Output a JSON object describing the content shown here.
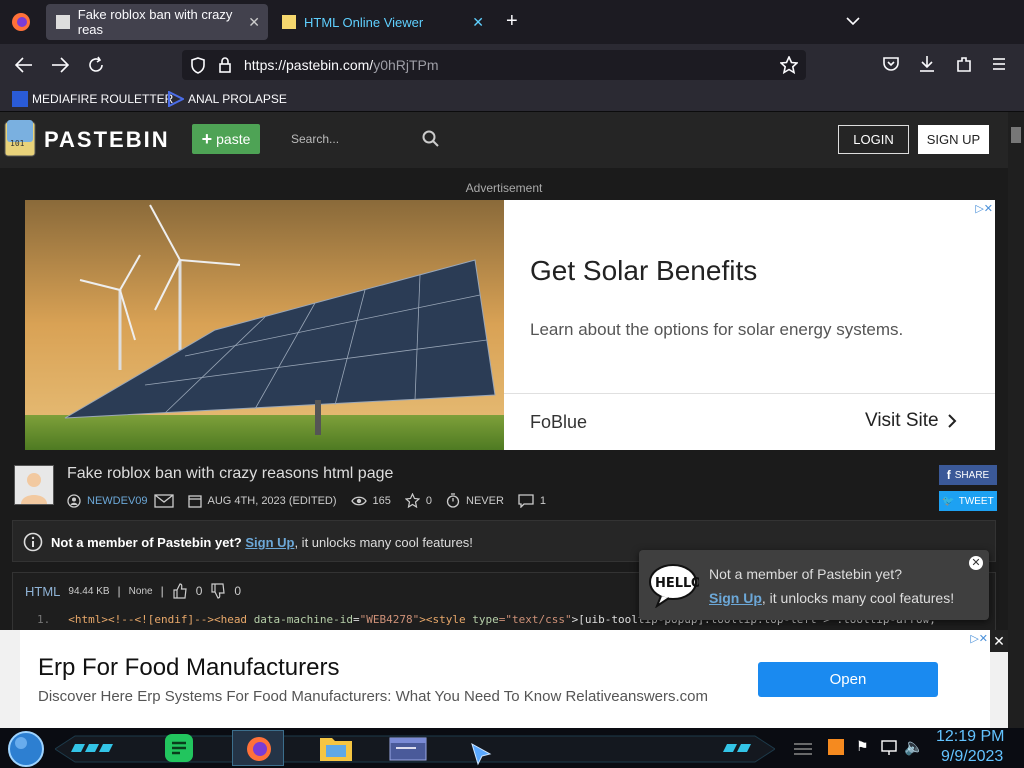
{
  "browser": {
    "tabs": [
      {
        "label": "Fake roblox ban with crazy reas",
        "active": true
      },
      {
        "label": "HTML Online Viewer",
        "active": false
      }
    ],
    "url_host": "https://pastebin.com/",
    "url_path": "y0hRjTPm",
    "bookmarks": [
      "MEDIAFIRE ROULETTER",
      "ANAL PROLAPSE"
    ]
  },
  "header": {
    "logo": "PASTEBIN",
    "paste_label": "paste",
    "search_placeholder": "Search...",
    "login_label": "LOGIN",
    "signup_label": "SIGN UP"
  },
  "ad_top": {
    "label": "Advertisement",
    "title": "Get Solar Benefits",
    "subtitle": "Learn about the options for solar energy systems.",
    "brand": "FoBlue",
    "cta": "Visit Site"
  },
  "paste": {
    "title": "Fake roblox ban with crazy reasons html page",
    "author": "NEWDEV09",
    "date": "AUG 4TH, 2023 (EDITED)",
    "views": "165",
    "stars": "0",
    "expire": "NEVER",
    "comments": "1",
    "share": "SHARE",
    "tweet": "TWEET"
  },
  "notice": {
    "bold": "Not a member of Pastebin yet?",
    "link": "Sign Up",
    "rest": ", it unlocks many cool features!"
  },
  "code": {
    "language": "HTML",
    "size": "94.44",
    "size_unit": "KB",
    "license": "None",
    "likes": "0",
    "dislikes": "0",
    "line_num": "1.",
    "line1_a": "<html><!--<![endif]--><head ",
    "line1_attr": "data-machine-id",
    "line1_eq": "=",
    "line1_val": "\"WEB4278\"",
    "line1_b": "><style ",
    "line1_attr2": "type",
    "line1_val2": "=\"text/css\"",
    "line1_c": ">[uib-tooltip-popup].tooltip.top-left > .tooltip-arrow,"
  },
  "popup": {
    "line1": "Not a member of Pastebin yet?",
    "link": "Sign Up",
    "rest": ", it unlocks many cool features!"
  },
  "ad_bottom": {
    "title": "Erp For Food Manufacturers",
    "subtitle": "Discover Here Erp Systems For Food Manufacturers: What You Need To Know Relativeanswers.com",
    "cta": "Open"
  },
  "taskbar": {
    "time": "12:19 PM",
    "date": "9/9/2023"
  }
}
